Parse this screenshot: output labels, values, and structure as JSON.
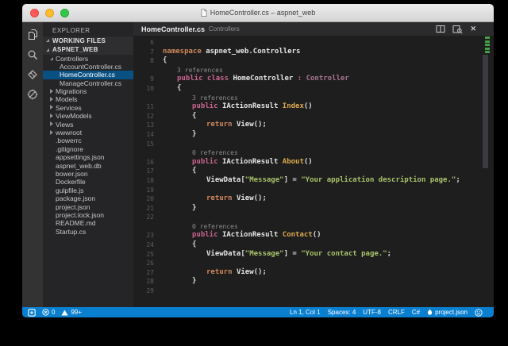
{
  "window": {
    "title": "HomeController.cs – aspnet_web"
  },
  "titlebar": {
    "icon": "document-icon",
    "traffic_lights": [
      "close",
      "minimize",
      "zoom"
    ]
  },
  "activity_bar": [
    {
      "name": "explorer-icon",
      "active": true
    },
    {
      "name": "search-icon",
      "active": false
    },
    {
      "name": "git-icon",
      "active": false
    },
    {
      "name": "debug-icon",
      "active": false
    }
  ],
  "sidebar": {
    "title": "EXPLORER",
    "rows": [
      {
        "kind": "header",
        "label": "WORKING FILES",
        "name": "working-files-section-header"
      },
      {
        "kind": "header",
        "label": "ASPNET_WEB",
        "name": "folder-section-header"
      },
      {
        "kind": "item",
        "label": "Controllers",
        "type": "folder",
        "lvl": 0,
        "open": true
      },
      {
        "kind": "item",
        "label": "AccountController.cs",
        "type": "file",
        "lvl": 1
      },
      {
        "kind": "item",
        "label": "HomeController.cs",
        "type": "file",
        "lvl": 1,
        "sel": true
      },
      {
        "kind": "item",
        "label": "ManageController.cs",
        "type": "file",
        "lvl": 1
      },
      {
        "kind": "item",
        "label": "Migrations",
        "type": "folder",
        "lvl": 0
      },
      {
        "kind": "item",
        "label": "Models",
        "type": "folder",
        "lvl": 0
      },
      {
        "kind": "item",
        "label": "Services",
        "type": "folder",
        "lvl": 0
      },
      {
        "kind": "item",
        "label": "ViewModels",
        "type": "folder",
        "lvl": 0
      },
      {
        "kind": "item",
        "label": "Views",
        "type": "folder",
        "lvl": 0
      },
      {
        "kind": "item",
        "label": "wwwroot",
        "type": "folder",
        "lvl": 0
      },
      {
        "kind": "item",
        "label": ".bowerrc",
        "type": "file",
        "lvl": 0
      },
      {
        "kind": "item",
        "label": ".gitignore",
        "type": "file",
        "lvl": 0
      },
      {
        "kind": "item",
        "label": "appsettings.json",
        "type": "file",
        "lvl": 0
      },
      {
        "kind": "item",
        "label": "aspnet_web.db",
        "type": "file",
        "lvl": 0
      },
      {
        "kind": "item",
        "label": "bower.json",
        "type": "file",
        "lvl": 0
      },
      {
        "kind": "item",
        "label": "Dockerfile",
        "type": "file",
        "lvl": 0
      },
      {
        "kind": "item",
        "label": "gulpfile.js",
        "type": "file",
        "lvl": 0
      },
      {
        "kind": "item",
        "label": "package.json",
        "type": "file",
        "lvl": 0
      },
      {
        "kind": "item",
        "label": "project.json",
        "type": "file",
        "lvl": 0
      },
      {
        "kind": "item",
        "label": "project.lock.json",
        "type": "file",
        "lvl": 0
      },
      {
        "kind": "item",
        "label": "README.md",
        "type": "file",
        "lvl": 0
      },
      {
        "kind": "item",
        "label": "Startup.cs",
        "type": "file",
        "lvl": 0
      }
    ]
  },
  "editor": {
    "tab": {
      "filename": "HomeController.cs",
      "path": "Controllers"
    },
    "actions": [
      {
        "name": "split-editor-icon"
      },
      {
        "name": "preview-icon"
      },
      {
        "name": "close-icon",
        "glyph": "✕"
      }
    ],
    "code": [
      {
        "n": "6",
        "i": 0,
        "tok": []
      },
      {
        "n": "7",
        "i": 0,
        "tok": [
          [
            "k1",
            "namespace"
          ],
          [
            "id",
            " aspnet_web.Controllers"
          ]
        ]
      },
      {
        "n": "8",
        "i": 0,
        "tok": [
          [
            "p",
            "{"
          ]
        ]
      },
      {
        "lens": "3 references",
        "i": 1
      },
      {
        "n": "9",
        "i": 1,
        "tok": [
          [
            "k2",
            "public class "
          ],
          [
            "id",
            "HomeController"
          ],
          [
            "k2",
            " : "
          ],
          [
            "t",
            "Controller"
          ]
        ]
      },
      {
        "n": "10",
        "i": 1,
        "tok": [
          [
            "p",
            "{"
          ]
        ]
      },
      {
        "lens": "3 references",
        "i": 2
      },
      {
        "n": "11",
        "i": 2,
        "tok": [
          [
            "k2",
            "public "
          ],
          [
            "id",
            "IActionResult "
          ],
          [
            "m",
            "Index"
          ],
          [
            "p",
            "()"
          ]
        ]
      },
      {
        "n": "12",
        "i": 2,
        "tok": [
          [
            "p",
            "{"
          ]
        ]
      },
      {
        "n": "13",
        "i": 3,
        "tok": [
          [
            "k1",
            "return "
          ],
          [
            "id",
            "View"
          ],
          [
            "p",
            "();"
          ]
        ]
      },
      {
        "n": "14",
        "i": 2,
        "tok": [
          [
            "p",
            "}"
          ]
        ]
      },
      {
        "n": "15",
        "i": 0,
        "tok": []
      },
      {
        "lens": "0 references",
        "i": 2
      },
      {
        "n": "16",
        "i": 2,
        "tok": [
          [
            "k2",
            "public "
          ],
          [
            "id",
            "IActionResult "
          ],
          [
            "m",
            "About"
          ],
          [
            "p",
            "()"
          ]
        ]
      },
      {
        "n": "17",
        "i": 2,
        "tok": [
          [
            "p",
            "{"
          ]
        ]
      },
      {
        "n": "18",
        "i": 3,
        "tok": [
          [
            "id",
            "ViewData"
          ],
          [
            "p",
            "["
          ],
          [
            "s",
            "\"Message\""
          ],
          [
            "p",
            "] = "
          ],
          [
            "s",
            "\"Your application description page.\""
          ],
          [
            "p",
            ";"
          ]
        ]
      },
      {
        "n": "19",
        "i": 0,
        "tok": []
      },
      {
        "n": "20",
        "i": 3,
        "tok": [
          [
            "k1",
            "return "
          ],
          [
            "id",
            "View"
          ],
          [
            "p",
            "();"
          ]
        ]
      },
      {
        "n": "21",
        "i": 2,
        "tok": [
          [
            "p",
            "}"
          ]
        ]
      },
      {
        "n": "22",
        "i": 0,
        "tok": []
      },
      {
        "lens": "0 references",
        "i": 2
      },
      {
        "n": "23",
        "i": 2,
        "tok": [
          [
            "k2",
            "public "
          ],
          [
            "id",
            "IActionResult "
          ],
          [
            "m",
            "Contact"
          ],
          [
            "p",
            "()"
          ]
        ]
      },
      {
        "n": "24",
        "i": 2,
        "tok": [
          [
            "p",
            "{"
          ]
        ]
      },
      {
        "n": "25",
        "i": 3,
        "tok": [
          [
            "id",
            "ViewData"
          ],
          [
            "p",
            "["
          ],
          [
            "s",
            "\"Message\""
          ],
          [
            "p",
            "] = "
          ],
          [
            "s",
            "\"Your contact page.\""
          ],
          [
            "p",
            ";"
          ]
        ]
      },
      {
        "n": "26",
        "i": 0,
        "tok": []
      },
      {
        "n": "27",
        "i": 3,
        "tok": [
          [
            "k1",
            "return "
          ],
          [
            "id",
            "View"
          ],
          [
            "p",
            "();"
          ]
        ]
      },
      {
        "n": "28",
        "i": 2,
        "tok": [
          [
            "p",
            "}"
          ]
        ]
      },
      {
        "n": "29",
        "i": 0,
        "tok": []
      }
    ]
  },
  "status_bar": {
    "left_icon": "status-square-icon",
    "errors": "0",
    "warnings": "99+",
    "right": [
      {
        "label": "Ln 1, Col 1",
        "name": "cursor-position"
      },
      {
        "label": "Spaces: 4",
        "name": "indentation"
      },
      {
        "label": "UTF-8",
        "name": "encoding"
      },
      {
        "label": "CRLF",
        "name": "eol"
      },
      {
        "label": "C#",
        "name": "language-mode"
      },
      {
        "label": "project.json",
        "name": "omnisharp-project",
        "icon": "flame-icon"
      },
      {
        "label": "",
        "name": "feedback-smiley",
        "icon": "smiley-icon"
      }
    ]
  },
  "colors": {
    "status_blue": "#0a7fd0",
    "selection_blue": "#0a5183",
    "keyword_orange": "#d1885c",
    "keyword_pink": "#c9648f",
    "type_muted": "#a8758f",
    "method_gold": "#dcaa4d",
    "string_green": "#a8c36b",
    "editor_bg": "#1e1e1e",
    "sidebar_bg": "#252527",
    "activitybar_bg": "#333334",
    "ruler_mark_green": "#43a047"
  }
}
